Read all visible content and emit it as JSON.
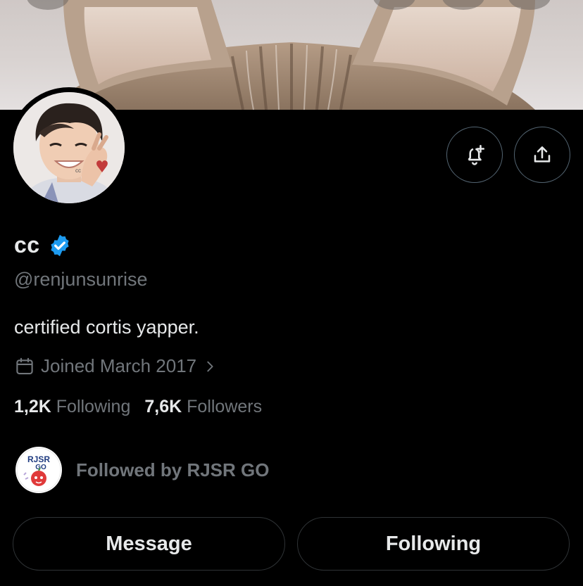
{
  "profile": {
    "display_name": "cc",
    "verified_icon": "verified-badge-icon",
    "handle": "@renjunsunrise",
    "bio": "certified cortis yapper.",
    "joined": "Joined March 2017",
    "avatar_text": "cc"
  },
  "stats": {
    "following_count": "1,2K",
    "following_label": "Following",
    "followers_count": "7,6K",
    "followers_label": "Followers"
  },
  "followed_by": {
    "text": "Followed by RJSR GO",
    "avatar_text": "RJSR GO"
  },
  "actions": {
    "notify_icon": "bell-plus-icon",
    "share_icon": "share-icon",
    "message_label": "Message",
    "following_label": "Following"
  },
  "colors": {
    "background": "#000000",
    "primary_text": "#e7e9ea",
    "secondary_text": "#71767b",
    "verified_blue": "#1d9bf0",
    "border": "#2f3336"
  }
}
